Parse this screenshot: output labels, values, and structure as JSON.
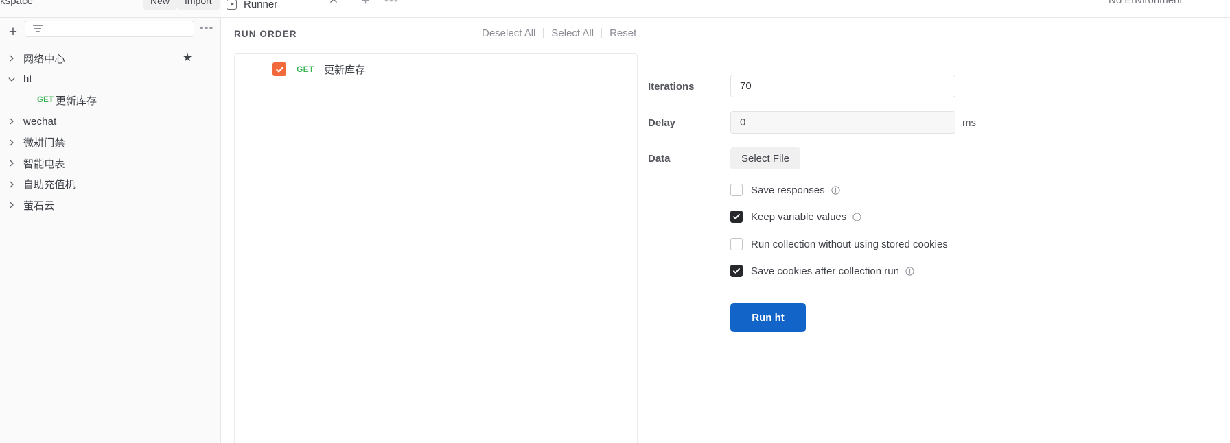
{
  "topbar": {
    "workspace_label": "kspace",
    "new_label": "New",
    "import_label": "Import",
    "tab_title": "Runner",
    "environment_label": "No Environment"
  },
  "sidebar": {
    "filter_placeholder": "",
    "items": [
      {
        "label": "网络中心",
        "expanded": false,
        "starred": true
      },
      {
        "label": "ht",
        "expanded": true,
        "starred": false
      },
      {
        "label": "wechat",
        "expanded": false,
        "starred": false
      },
      {
        "label": "微耕门禁",
        "expanded": false,
        "starred": false
      },
      {
        "label": "智能电表",
        "expanded": false,
        "starred": false
      },
      {
        "label": "自助充值机",
        "expanded": false,
        "starred": false
      },
      {
        "label": "萤石云",
        "expanded": false,
        "starred": false
      }
    ],
    "child_request": {
      "method": "GET",
      "name": "更新库存"
    }
  },
  "runorder": {
    "title": "RUN ORDER",
    "deselect_all": "Deselect All",
    "select_all": "Select All",
    "reset": "Reset",
    "requests": [
      {
        "checked": true,
        "method": "GET",
        "name": "更新库存"
      }
    ]
  },
  "settings": {
    "iterations_label": "Iterations",
    "iterations_value": "70",
    "delay_label": "Delay",
    "delay_value": "0",
    "delay_unit": "ms",
    "data_label": "Data",
    "select_file_label": "Select File",
    "options": [
      {
        "label": "Save responses",
        "checked": false,
        "info": true
      },
      {
        "label": "Keep variable values",
        "checked": true,
        "info": true
      },
      {
        "label": "Run collection without using stored cookies",
        "checked": false,
        "info": false
      },
      {
        "label": "Save cookies after collection run",
        "checked": true,
        "info": true
      }
    ],
    "run_button_label": "Run ht"
  },
  "colors": {
    "accent_orange": "#f26a3b",
    "method_green": "#3bb657",
    "run_blue": "#1264c8",
    "checkbox_dark": "#26282c"
  }
}
